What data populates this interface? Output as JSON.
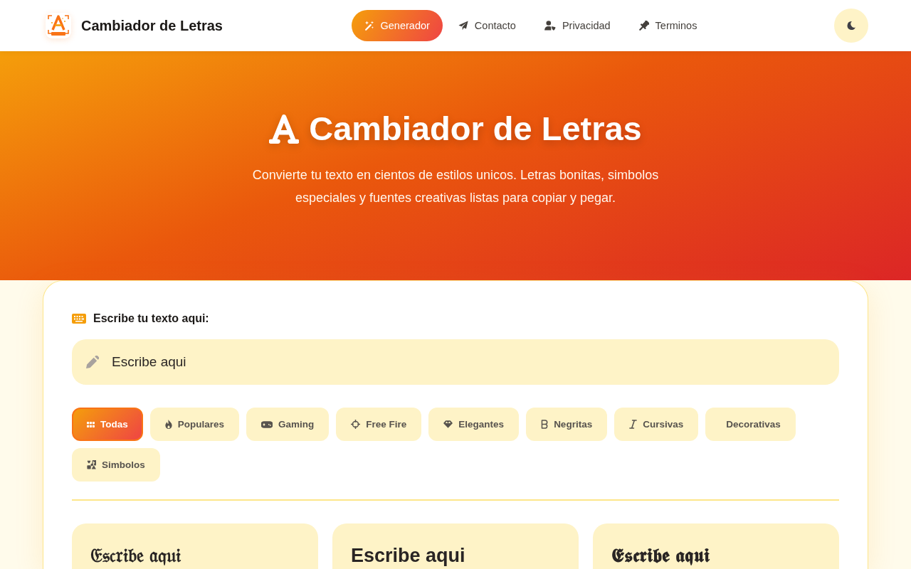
{
  "header": {
    "brand": "Cambiador de Letras",
    "nav": [
      {
        "label": "Generador",
        "selected": true
      },
      {
        "label": "Contacto",
        "selected": false
      },
      {
        "label": "Privacidad",
        "selected": false
      },
      {
        "label": "Terminos",
        "selected": false
      }
    ]
  },
  "hero": {
    "title": "Cambiador de Letras",
    "subtitle": "Convierte tu texto en cientos de estilos unicos. Letras bonitas, simbolos especiales y fuentes creativas listas para copiar y pegar."
  },
  "editor": {
    "label": "Escribe tu texto aqui:",
    "input": {
      "value": "Escribe aqui"
    },
    "categories": [
      {
        "label": "Todas",
        "selected": true
      },
      {
        "label": "Populares",
        "selected": false
      },
      {
        "label": "Gaming",
        "selected": false
      },
      {
        "label": "Free Fire",
        "selected": false
      },
      {
        "label": "Elegantes",
        "selected": false
      },
      {
        "label": "Negritas",
        "selected": false
      },
      {
        "label": "Cursivas",
        "selected": false
      },
      {
        "label": "Decorativas",
        "selected": false
      },
      {
        "label": "Simbolos",
        "selected": false
      }
    ],
    "results": [
      {
        "text": "𝔈𝔰𝔠𝔯𝔦𝔟𝔢 𝔞𝔮𝔲𝔦"
      },
      {
        "text": "Escribe aqui"
      },
      {
        "text": "𝕰𝖘𝖈𝖗𝖎𝖇𝖊 𝖆𝖖𝖚𝖎"
      }
    ]
  }
}
